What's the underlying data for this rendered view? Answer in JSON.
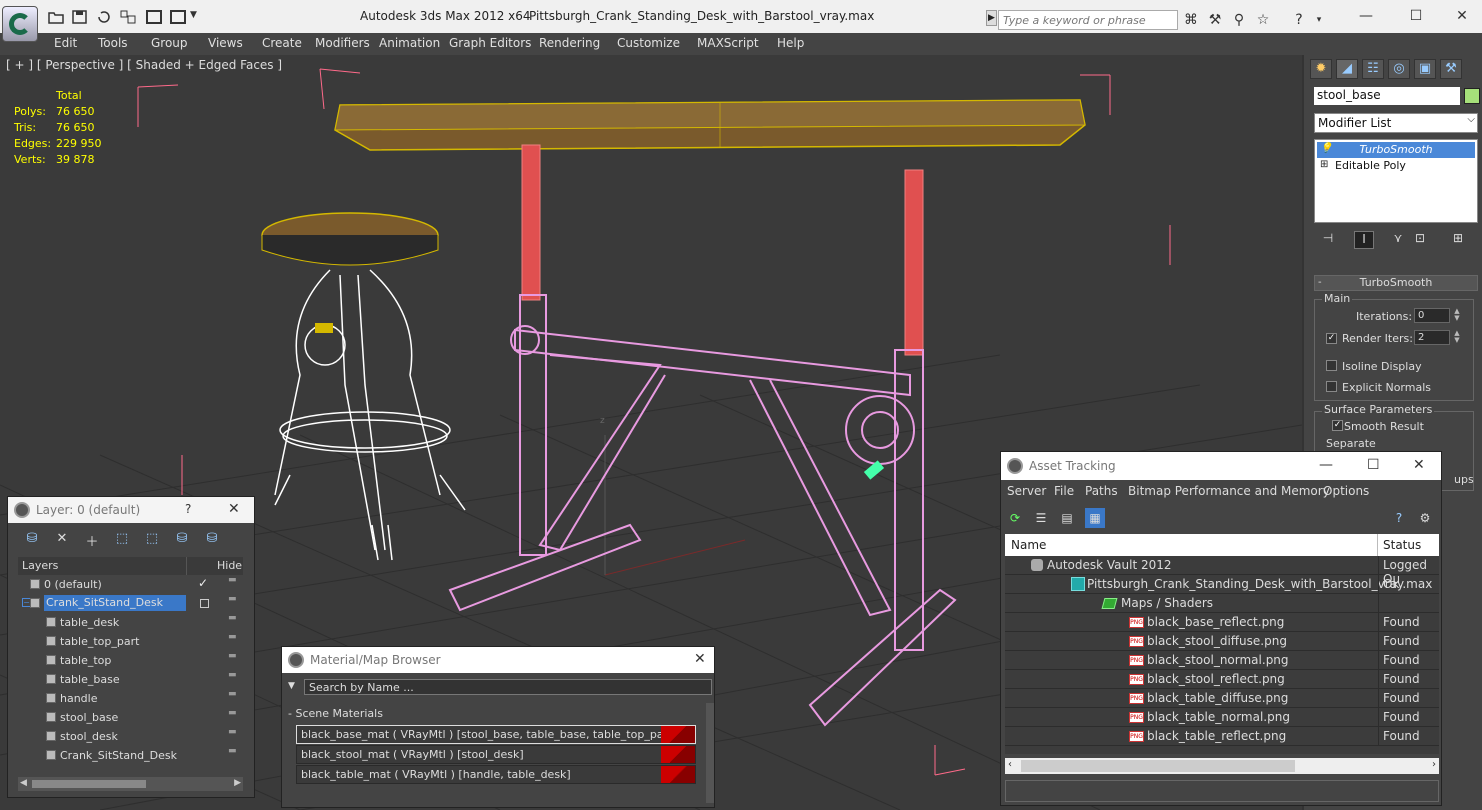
{
  "window": {
    "app_title": "Autodesk 3ds Max  2012 x64",
    "file_title": "Pittsburgh_Crank_Standing_Desk_with_Barstool_vray.max",
    "search_placeholder": "Type a keyword or phrase"
  },
  "menu": [
    "Edit",
    "Tools",
    "Group",
    "Views",
    "Create",
    "Modifiers",
    "Animation",
    "Graph Editors",
    "Rendering",
    "Customize",
    "MAXScript",
    "Help"
  ],
  "viewport": {
    "label": "[ + ] [ Perspective ] [ Shaded + Edged Faces ]",
    "stats_header": "Total",
    "stats": [
      {
        "key": "Polys:",
        "value": "76 650"
      },
      {
        "key": "Tris:",
        "value": "76 650"
      },
      {
        "key": "Edges:",
        "value": "229 950"
      },
      {
        "key": "Verts:",
        "value": "39 878"
      }
    ],
    "axis_z": "z",
    "colors": {
      "table_top": "#7a5a2c",
      "table_edge": "#d4b800",
      "frame": "#e89ae0",
      "column": "#e05050",
      "stool": "#ffffff",
      "grid": "#2c2c2c",
      "box": "#ff6a8a"
    }
  },
  "command_panel": {
    "object_name": "stool_base",
    "object_color": "#a6e07a",
    "modifier_list_label": "Modifier List",
    "stack": [
      "TurboSmooth",
      "Editable Poly"
    ],
    "rollout_title": "TurboSmooth",
    "main_label": "Main",
    "iterations_label": "Iterations:",
    "iterations_value": "0",
    "render_iters_label": "Render Iters:",
    "render_iters_value": "2",
    "isoline_label": "Isoline Display",
    "explicit_normals_label": "Explicit Normals",
    "surface_params_label": "Surface Parameters",
    "smooth_result_label": "Smooth Result",
    "separate_label": "Separate",
    "partial_label": "ups"
  },
  "layer_window": {
    "title": "Layer: 0 (default)",
    "help": "?",
    "close": "✕",
    "col_layers": "Layers",
    "col_hide": "Hide",
    "rows": [
      {
        "name": "0 (default)",
        "level": 0,
        "selected": false,
        "current": true
      },
      {
        "name": "Crank_SitStand_Desk",
        "level": 0,
        "selected": true,
        "current": false
      },
      {
        "name": "table_desk",
        "level": 1,
        "selected": false,
        "current": false
      },
      {
        "name": "table_top_part",
        "level": 1,
        "selected": false,
        "current": false
      },
      {
        "name": "table_top",
        "level": 1,
        "selected": false,
        "current": false
      },
      {
        "name": "table_base",
        "level": 1,
        "selected": false,
        "current": false
      },
      {
        "name": "handle",
        "level": 1,
        "selected": false,
        "current": false
      },
      {
        "name": "stool_base",
        "level": 1,
        "selected": false,
        "current": false
      },
      {
        "name": "stool_desk",
        "level": 1,
        "selected": false,
        "current": false
      },
      {
        "name": "Crank_SitStand_Desk",
        "level": 1,
        "selected": false,
        "current": false
      }
    ]
  },
  "material_browser": {
    "title": "Material/Map Browser",
    "close": "✕",
    "search_placeholder": "Search by Name ...",
    "section": "Scene Materials",
    "materials": [
      "black_base_mat ( VRayMtl ) [stool_base, table_base, table_top_part]",
      "black_stool_mat ( VRayMtl ) [stool_desk]",
      "black_table_mat ( VRayMtl ) [handle, table_desk]"
    ]
  },
  "asset_tracking": {
    "title": "Asset Tracking",
    "menu": [
      "Server",
      "File",
      "Paths",
      "Bitmap Performance and Memory",
      "Options"
    ],
    "col_name": "Name",
    "col_status": "Status",
    "rows": [
      {
        "name": "Autodesk Vault 2012",
        "status": "Logged Ou",
        "level": 0,
        "type": "vault"
      },
      {
        "name": "Pittsburgh_Crank_Standing_Desk_with_Barstool_vray.max",
        "status": "Ok",
        "level": 1,
        "type": "max"
      },
      {
        "name": "Maps / Shaders",
        "status": "",
        "level": 2,
        "type": "folder"
      },
      {
        "name": "black_base_reflect.png",
        "status": "Found",
        "level": 3,
        "type": "png"
      },
      {
        "name": "black_stool_diffuse.png",
        "status": "Found",
        "level": 3,
        "type": "png"
      },
      {
        "name": "black_stool_normal.png",
        "status": "Found",
        "level": 3,
        "type": "png"
      },
      {
        "name": "black_stool_reflect.png",
        "status": "Found",
        "level": 3,
        "type": "png"
      },
      {
        "name": "black_table_diffuse.png",
        "status": "Found",
        "level": 3,
        "type": "png"
      },
      {
        "name": "black_table_normal.png",
        "status": "Found",
        "level": 3,
        "type": "png"
      },
      {
        "name": "black_table_reflect.png",
        "status": "Found",
        "level": 3,
        "type": "png"
      }
    ],
    "png_badge": "PNG"
  }
}
